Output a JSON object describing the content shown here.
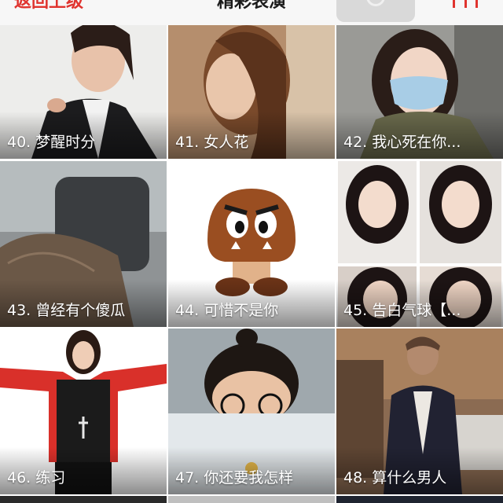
{
  "nav": {
    "back_label": "返回上级",
    "title": "精彩表演"
  },
  "tiles": [
    {
      "caption": "40. 梦醒时分"
    },
    {
      "caption": "41. 女人花"
    },
    {
      "caption": "42. 我心死在你..."
    },
    {
      "caption": "43. 曾经有个傻瓜"
    },
    {
      "caption": "44. 可惜不是你"
    },
    {
      "caption": "45. 告白气球【..."
    },
    {
      "caption": "46. 练习"
    },
    {
      "caption": "47. 你还要我怎样"
    },
    {
      "caption": "48. 算什么男人"
    }
  ],
  "colors": {
    "accent": "#e0342f",
    "caption_text": "#ffffff"
  },
  "icons": {
    "menu": "menu-bars-icon"
  }
}
